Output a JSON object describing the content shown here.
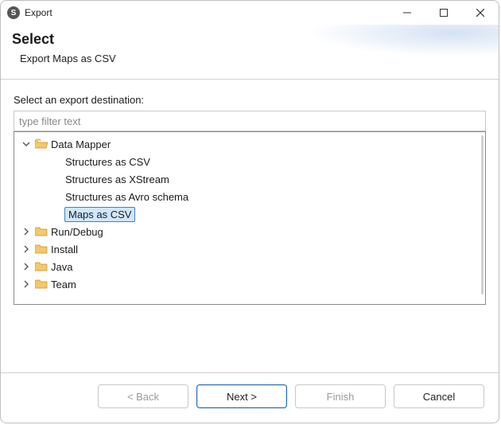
{
  "window": {
    "title": "Export"
  },
  "banner": {
    "title": "Select",
    "subtitle": "Export Maps as CSV"
  },
  "fields": {
    "destination_label": "Select an export destination:",
    "filter_placeholder": "type filter text"
  },
  "tree": {
    "nodes": [
      {
        "label": "Data Mapper",
        "expanded": true,
        "folder": true,
        "children": [
          {
            "label": "Structures as CSV"
          },
          {
            "label": "Structures as XStream"
          },
          {
            "label": "Structures as Avro schema"
          },
          {
            "label": "Maps as CSV",
            "selected": true
          }
        ]
      },
      {
        "label": "Run/Debug",
        "expanded": false,
        "folder": true
      },
      {
        "label": "Install",
        "expanded": false,
        "folder": true
      },
      {
        "label": "Java",
        "expanded": false,
        "folder": true
      },
      {
        "label": "Team",
        "expanded": false,
        "folder": true
      }
    ]
  },
  "buttons": {
    "back": "< Back",
    "next": "Next >",
    "finish": "Finish",
    "cancel": "Cancel"
  }
}
